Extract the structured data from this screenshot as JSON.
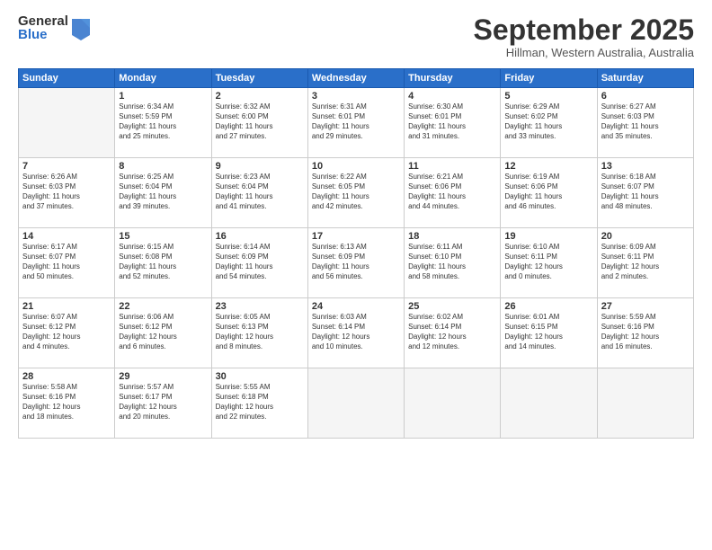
{
  "logo": {
    "general": "General",
    "blue": "Blue"
  },
  "title": "September 2025",
  "location": "Hillman, Western Australia, Australia",
  "headers": [
    "Sunday",
    "Monday",
    "Tuesday",
    "Wednesday",
    "Thursday",
    "Friday",
    "Saturday"
  ],
  "weeks": [
    [
      {
        "day": "",
        "lines": []
      },
      {
        "day": "1",
        "lines": [
          "Sunrise: 6:34 AM",
          "Sunset: 5:59 PM",
          "Daylight: 11 hours",
          "and 25 minutes."
        ]
      },
      {
        "day": "2",
        "lines": [
          "Sunrise: 6:32 AM",
          "Sunset: 6:00 PM",
          "Daylight: 11 hours",
          "and 27 minutes."
        ]
      },
      {
        "day": "3",
        "lines": [
          "Sunrise: 6:31 AM",
          "Sunset: 6:01 PM",
          "Daylight: 11 hours",
          "and 29 minutes."
        ]
      },
      {
        "day": "4",
        "lines": [
          "Sunrise: 6:30 AM",
          "Sunset: 6:01 PM",
          "Daylight: 11 hours",
          "and 31 minutes."
        ]
      },
      {
        "day": "5",
        "lines": [
          "Sunrise: 6:29 AM",
          "Sunset: 6:02 PM",
          "Daylight: 11 hours",
          "and 33 minutes."
        ]
      },
      {
        "day": "6",
        "lines": [
          "Sunrise: 6:27 AM",
          "Sunset: 6:03 PM",
          "Daylight: 11 hours",
          "and 35 minutes."
        ]
      }
    ],
    [
      {
        "day": "7",
        "lines": [
          "Sunrise: 6:26 AM",
          "Sunset: 6:03 PM",
          "Daylight: 11 hours",
          "and 37 minutes."
        ]
      },
      {
        "day": "8",
        "lines": [
          "Sunrise: 6:25 AM",
          "Sunset: 6:04 PM",
          "Daylight: 11 hours",
          "and 39 minutes."
        ]
      },
      {
        "day": "9",
        "lines": [
          "Sunrise: 6:23 AM",
          "Sunset: 6:04 PM",
          "Daylight: 11 hours",
          "and 41 minutes."
        ]
      },
      {
        "day": "10",
        "lines": [
          "Sunrise: 6:22 AM",
          "Sunset: 6:05 PM",
          "Daylight: 11 hours",
          "and 42 minutes."
        ]
      },
      {
        "day": "11",
        "lines": [
          "Sunrise: 6:21 AM",
          "Sunset: 6:06 PM",
          "Daylight: 11 hours",
          "and 44 minutes."
        ]
      },
      {
        "day": "12",
        "lines": [
          "Sunrise: 6:19 AM",
          "Sunset: 6:06 PM",
          "Daylight: 11 hours",
          "and 46 minutes."
        ]
      },
      {
        "day": "13",
        "lines": [
          "Sunrise: 6:18 AM",
          "Sunset: 6:07 PM",
          "Daylight: 11 hours",
          "and 48 minutes."
        ]
      }
    ],
    [
      {
        "day": "14",
        "lines": [
          "Sunrise: 6:17 AM",
          "Sunset: 6:07 PM",
          "Daylight: 11 hours",
          "and 50 minutes."
        ]
      },
      {
        "day": "15",
        "lines": [
          "Sunrise: 6:15 AM",
          "Sunset: 6:08 PM",
          "Daylight: 11 hours",
          "and 52 minutes."
        ]
      },
      {
        "day": "16",
        "lines": [
          "Sunrise: 6:14 AM",
          "Sunset: 6:09 PM",
          "Daylight: 11 hours",
          "and 54 minutes."
        ]
      },
      {
        "day": "17",
        "lines": [
          "Sunrise: 6:13 AM",
          "Sunset: 6:09 PM",
          "Daylight: 11 hours",
          "and 56 minutes."
        ]
      },
      {
        "day": "18",
        "lines": [
          "Sunrise: 6:11 AM",
          "Sunset: 6:10 PM",
          "Daylight: 11 hours",
          "and 58 minutes."
        ]
      },
      {
        "day": "19",
        "lines": [
          "Sunrise: 6:10 AM",
          "Sunset: 6:11 PM",
          "Daylight: 12 hours",
          "and 0 minutes."
        ]
      },
      {
        "day": "20",
        "lines": [
          "Sunrise: 6:09 AM",
          "Sunset: 6:11 PM",
          "Daylight: 12 hours",
          "and 2 minutes."
        ]
      }
    ],
    [
      {
        "day": "21",
        "lines": [
          "Sunrise: 6:07 AM",
          "Sunset: 6:12 PM",
          "Daylight: 12 hours",
          "and 4 minutes."
        ]
      },
      {
        "day": "22",
        "lines": [
          "Sunrise: 6:06 AM",
          "Sunset: 6:12 PM",
          "Daylight: 12 hours",
          "and 6 minutes."
        ]
      },
      {
        "day": "23",
        "lines": [
          "Sunrise: 6:05 AM",
          "Sunset: 6:13 PM",
          "Daylight: 12 hours",
          "and 8 minutes."
        ]
      },
      {
        "day": "24",
        "lines": [
          "Sunrise: 6:03 AM",
          "Sunset: 6:14 PM",
          "Daylight: 12 hours",
          "and 10 minutes."
        ]
      },
      {
        "day": "25",
        "lines": [
          "Sunrise: 6:02 AM",
          "Sunset: 6:14 PM",
          "Daylight: 12 hours",
          "and 12 minutes."
        ]
      },
      {
        "day": "26",
        "lines": [
          "Sunrise: 6:01 AM",
          "Sunset: 6:15 PM",
          "Daylight: 12 hours",
          "and 14 minutes."
        ]
      },
      {
        "day": "27",
        "lines": [
          "Sunrise: 5:59 AM",
          "Sunset: 6:16 PM",
          "Daylight: 12 hours",
          "and 16 minutes."
        ]
      }
    ],
    [
      {
        "day": "28",
        "lines": [
          "Sunrise: 5:58 AM",
          "Sunset: 6:16 PM",
          "Daylight: 12 hours",
          "and 18 minutes."
        ]
      },
      {
        "day": "29",
        "lines": [
          "Sunrise: 5:57 AM",
          "Sunset: 6:17 PM",
          "Daylight: 12 hours",
          "and 20 minutes."
        ]
      },
      {
        "day": "30",
        "lines": [
          "Sunrise: 5:55 AM",
          "Sunset: 6:18 PM",
          "Daylight: 12 hours",
          "and 22 minutes."
        ]
      },
      {
        "day": "",
        "lines": []
      },
      {
        "day": "",
        "lines": []
      },
      {
        "day": "",
        "lines": []
      },
      {
        "day": "",
        "lines": []
      }
    ]
  ]
}
